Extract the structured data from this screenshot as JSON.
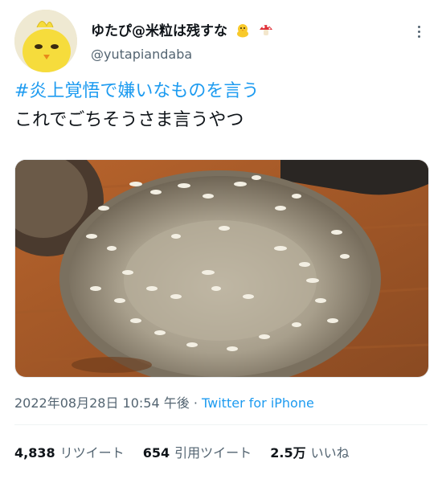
{
  "author": {
    "display_name": "ゆたぴ@米粒は残すな",
    "handle": "@yutapiandaba",
    "avatar_icon": "chick-avatar-icon",
    "name_emojis": [
      "chick-icon",
      "mushroom-icon"
    ]
  },
  "tweet": {
    "hashtag": "#炎上覚悟で嫌いなものを言う",
    "text": "これでごちそうさま言うやつ"
  },
  "media": {
    "description_icon": "rice-bowl-photo"
  },
  "meta": {
    "timestamp": "2022年08月28日 10:54 午後",
    "separator": "·",
    "source": "Twitter for iPhone"
  },
  "stats": {
    "retweets_count": "4,838",
    "retweets_label": "リツイート",
    "quotes_count": "654",
    "quotes_label": "引用ツイート",
    "likes_count": "2.5万",
    "likes_label": "いいね"
  },
  "colors": {
    "accent": "#1d9bf0",
    "text": "#0f1419",
    "secondary": "#536471"
  }
}
